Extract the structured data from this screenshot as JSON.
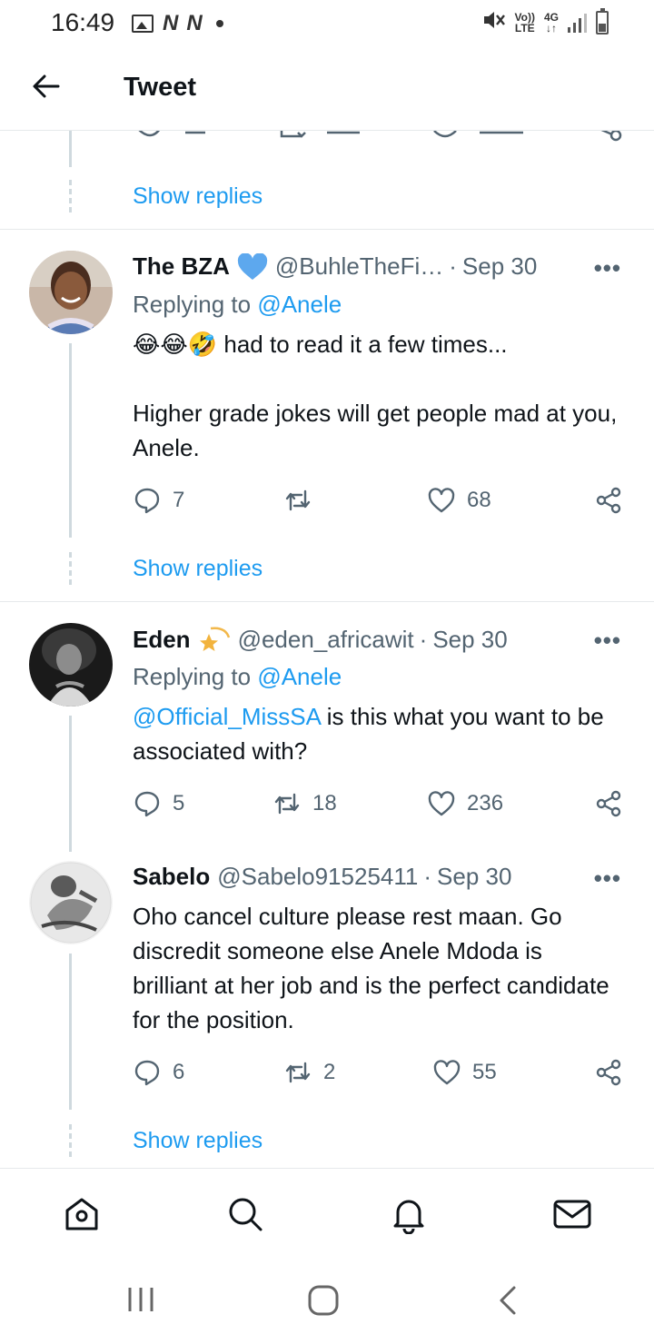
{
  "status_bar": {
    "time": "16:49",
    "left_icons": [
      "image-icon",
      "n-icon",
      "n-icon",
      "dot-icon"
    ],
    "volte_top": "Vo))",
    "volte_bottom": "LTE",
    "net_top": "4G",
    "net_bottom": "↓↑"
  },
  "header": {
    "title": "Tweet"
  },
  "links": {
    "show_replies": "Show replies"
  },
  "tweets": [
    {
      "name": "The BZA",
      "badge": "blue-heart",
      "handle": "@BuhleTheFi…",
      "separator": "·",
      "date": "Sep 30",
      "replying_prefix": "Replying to",
      "replying_to": "@Anele",
      "emojis": "😂😂🤣",
      "text_line1": " had to read it a few times...",
      "text_para2": "Higher grade jokes will get people mad at you, Anele.",
      "replies": "7",
      "retweets": "",
      "likes": "68"
    },
    {
      "name": "Eden",
      "badge": "dizzy-star",
      "handle": "@eden_africawit",
      "separator": "·",
      "date": "Sep 30",
      "replying_prefix": "Replying to",
      "replying_to": "@Anele",
      "mention": "@Official_MissSA",
      "text": " is this what you want to be associated with?",
      "replies": "5",
      "retweets": "18",
      "likes": "236"
    },
    {
      "name": "Sabelo",
      "handle": "@Sabelo91525411",
      "separator": "·",
      "date": "Sep 30",
      "text": "Oho cancel culture please rest maan. Go discredit someone else Anele Mdoda is brilliant at her job and is the perfect candidate for the position.",
      "replies": "6",
      "retweets": "2",
      "likes": "55"
    }
  ],
  "more_label": "•••",
  "bottom_nav": [
    "home-icon",
    "search-icon",
    "notifications-icon",
    "messages-icon"
  ],
  "colors": {
    "accent": "#1d9bf0",
    "secondary_text": "#536471",
    "divider": "#e6e9eb"
  }
}
